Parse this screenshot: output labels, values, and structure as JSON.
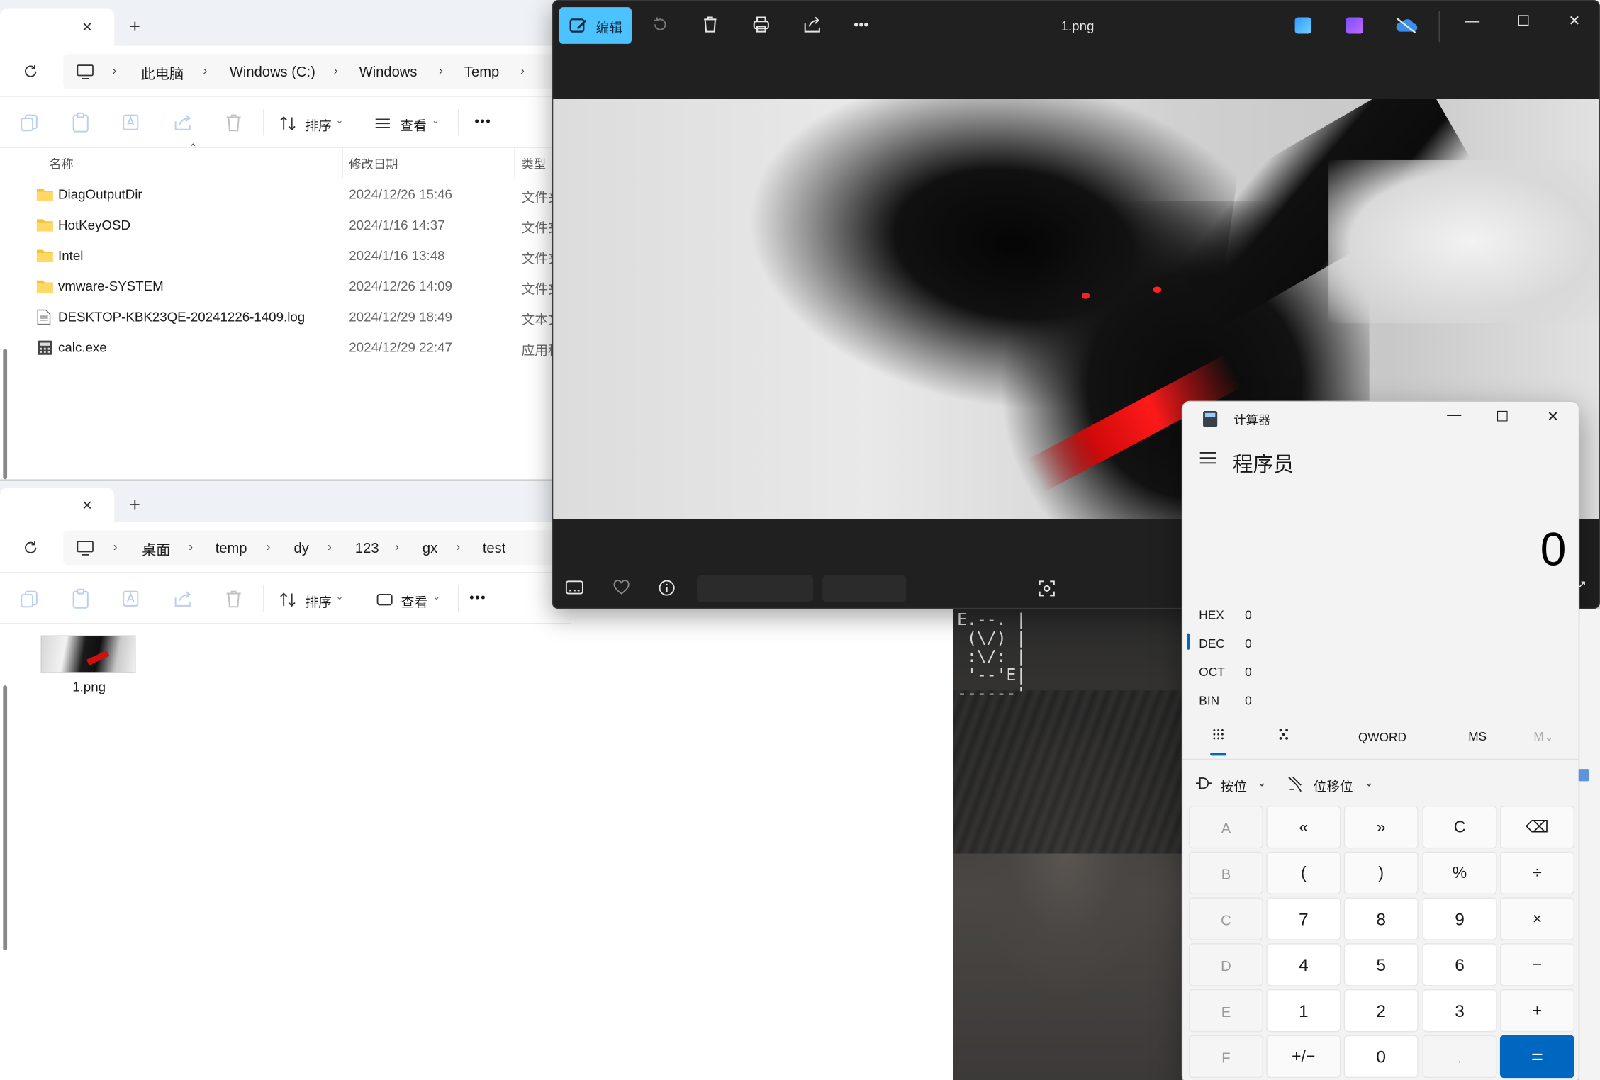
{
  "explorer_top": {
    "tab": {
      "close": "✕",
      "new": "+"
    },
    "breadcrumb": [
      "此电脑",
      "Windows (C:)",
      "Windows",
      "Temp"
    ],
    "toolbar": {
      "sort_label": "排序",
      "view_label": "查看",
      "more": "•••"
    },
    "columns": {
      "name": "名称",
      "modified": "修改日期",
      "type": "类型"
    },
    "files": [
      {
        "name": "DiagOutputDir",
        "modified": "2024/12/26 15:46",
        "type": "文件夹",
        "icon": "folder-icon"
      },
      {
        "name": "HotKeyOSD",
        "modified": "2024/1/16 14:37",
        "type": "文件夹",
        "icon": "folder-icon"
      },
      {
        "name": "Intel",
        "modified": "2024/1/16 13:48",
        "type": "文件夹",
        "icon": "folder-icon"
      },
      {
        "name": "vmware-SYSTEM",
        "modified": "2024/12/26 14:09",
        "type": "文件夹",
        "icon": "folder-icon"
      },
      {
        "name": "DESKTOP-KBK23QE-20241226-1409.log",
        "modified": "2024/12/29 18:49",
        "type": "文本文档",
        "icon": "text-file-icon"
      },
      {
        "name": "calc.exe",
        "modified": "2024/12/29 22:47",
        "type": "应用程序",
        "icon": "exe-file-icon"
      }
    ]
  },
  "explorer_bottom": {
    "tab": {
      "close": "✕",
      "new": "+"
    },
    "breadcrumb": [
      "桌面",
      "temp",
      "dy",
      "123",
      "gx",
      "test"
    ],
    "toolbar": {
      "sort_label": "排序",
      "view_label": "查看",
      "more": "•••"
    },
    "files": [
      {
        "name": "1.png",
        "icon": "image-thumbnail"
      }
    ]
  },
  "photos": {
    "edit_label": "编辑",
    "title": "1.png",
    "window_controls": {
      "minimize": "—",
      "maximize": "☐",
      "close": "✕"
    }
  },
  "terminal_art": [
    "E.--. |",
    " (\\/) |",
    " :\\/: |",
    " '--'E|",
    "------'"
  ],
  "calculator": {
    "app_title": "计算器",
    "mode": "程序员",
    "display": "0",
    "bases": [
      {
        "label": "HEX",
        "value": "0"
      },
      {
        "label": "DEC",
        "value": "0",
        "active": true
      },
      {
        "label": "OCT",
        "value": "0"
      },
      {
        "label": "BIN",
        "value": "0"
      }
    ],
    "word_size": "QWORD",
    "memory_store": "MS",
    "memory_menu": "M⌄",
    "bitwise_label": "按位",
    "bitshift_label": "位移位",
    "keys": [
      [
        "A",
        "«",
        "»",
        "C",
        "⌫"
      ],
      [
        "B",
        "(",
        ")",
        "%",
        "÷"
      ],
      [
        "C",
        "7",
        "8",
        "9",
        "×"
      ],
      [
        "D",
        "4",
        "5",
        "6",
        "−"
      ],
      [
        "E",
        "1",
        "2",
        "3",
        "+"
      ],
      [
        "F",
        "+/−",
        "0",
        ".",
        "="
      ]
    ],
    "accent": "#0067c0"
  }
}
